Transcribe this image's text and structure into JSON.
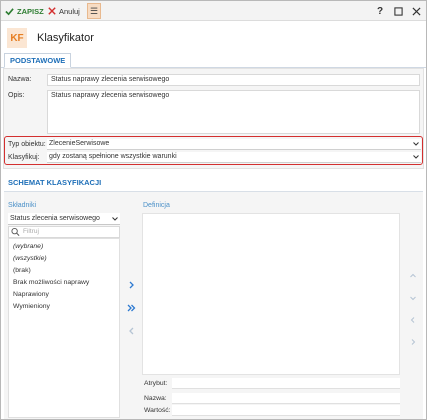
{
  "toolbar": {
    "save_label": "ZAPISZ",
    "cancel_label": "Anuluj",
    "menu_icon": "☰",
    "help_label": "?"
  },
  "header": {
    "logo_text": "KF",
    "title": "Klasyfikator"
  },
  "tabs": [
    {
      "label": "PODSTAWOWE",
      "active": true
    }
  ],
  "form": {
    "name_label": "Nazwa:",
    "name_value": "Status naprawy zlecenia serwisowego",
    "desc_label": "Opis:",
    "desc_value": "Status naprawy zlecenia serwisowego",
    "object_type_label": "Typ obiektu:",
    "object_type_value": "ZlecenieSerwisowe",
    "classify_label": "Klasyfikuj:",
    "classify_value": "gdy zostaną spełnione wszystkie warunki"
  },
  "schema": {
    "title": "SCHEMAT KLASYFIKACJI",
    "components_label": "Składniki",
    "definition_label": "Definicja",
    "component_select": "Status zlecenia serwisowego",
    "filter_placeholder": "Filtruj",
    "items": [
      {
        "label": "(wybrane)",
        "italic": true
      },
      {
        "label": "(wszystkie)",
        "italic": true
      },
      {
        "label": "(brak)",
        "italic": false
      },
      {
        "label": "Brak możliwości naprawy",
        "italic": false
      },
      {
        "label": "Naprawiony",
        "italic": false
      },
      {
        "label": "Wymieniony",
        "italic": false
      }
    ],
    "attribute_label": "Atrybut:",
    "name_label": "Nazwa:",
    "value_label": "Wartość:"
  },
  "colors": {
    "accent": "#1e6fb8",
    "save_green": "#2e7d32",
    "highlight_red": "#d32f2f",
    "logo_orange": "#e67e22"
  }
}
